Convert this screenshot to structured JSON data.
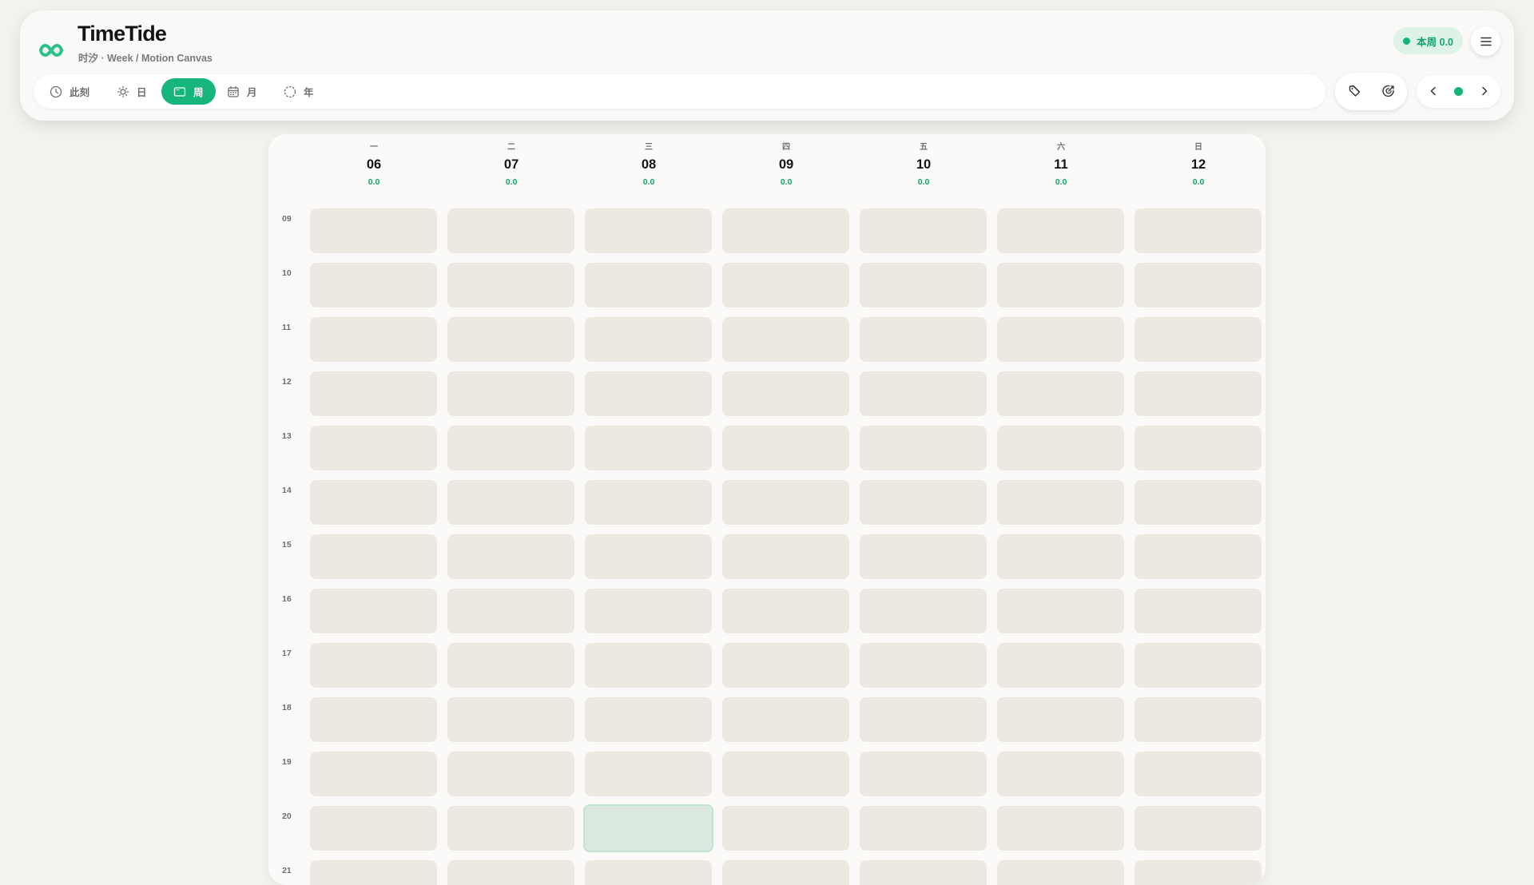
{
  "app": {
    "title": "TimeTide",
    "subtitle": "时汐 · Week / Motion Canvas",
    "logo_icon": "infinity-logo-icon",
    "accent_color": "#16b57c"
  },
  "header": {
    "week_badge": "本周 0.0",
    "menu_icon": "hamburger-menu-icon"
  },
  "tabs": [
    {
      "label": "此刻",
      "icon": "clock-icon",
      "active": false
    },
    {
      "label": "日",
      "icon": "sun-icon",
      "active": false
    },
    {
      "label": "周",
      "icon": "week-window-icon",
      "active": true
    },
    {
      "label": "月",
      "icon": "calendar-icon",
      "active": false
    },
    {
      "label": "年",
      "icon": "dashed-circle-icon",
      "active": false
    }
  ],
  "tools": [
    "tag-icon",
    "target-icon"
  ],
  "nav": [
    "chevron-left-icon",
    "today-dot",
    "chevron-right-icon"
  ],
  "week": {
    "days": [
      {
        "name": "一",
        "date": "06",
        "total": "0.0"
      },
      {
        "name": "二",
        "date": "07",
        "total": "0.0"
      },
      {
        "name": "三",
        "date": "08",
        "total": "0.0"
      },
      {
        "name": "四",
        "date": "09",
        "total": "0.0"
      },
      {
        "name": "五",
        "date": "10",
        "total": "0.0"
      },
      {
        "name": "六",
        "date": "11",
        "total": "0.0"
      },
      {
        "name": "日",
        "date": "12",
        "total": "0.0"
      }
    ],
    "hours": [
      "09",
      "10",
      "11",
      "12",
      "13",
      "14",
      "15",
      "16",
      "17",
      "18",
      "19",
      "20",
      "21"
    ],
    "current_slot": {
      "day": "08",
      "hour": "20"
    }
  }
}
